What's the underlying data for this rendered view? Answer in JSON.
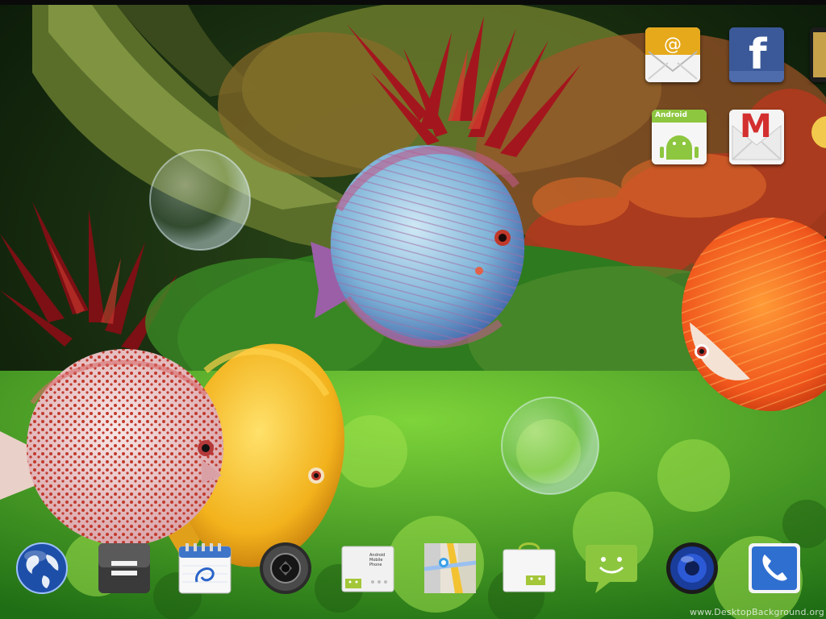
{
  "wallpaper": {
    "name": "aquarium live wallpaper",
    "colors": {
      "water": "#0c2a10",
      "plants": "#3fa52a",
      "redPlants": "#9c1a1a",
      "orangeFish": "#f0561c",
      "yellowFish": "#f2b21c",
      "blueFish": "#7fb4d8"
    }
  },
  "homescreen_icons": [
    {
      "name": "email-icon",
      "label": ""
    },
    {
      "name": "facebook-icon",
      "label": "f"
    },
    {
      "name": "android-market-icon",
      "label": "Android"
    },
    {
      "name": "gmail-icon",
      "label": "M"
    }
  ],
  "dock_icons": [
    {
      "name": "browser-globe-icon"
    },
    {
      "name": "calculator-icon"
    },
    {
      "name": "calendar-icon"
    },
    {
      "name": "camera-icon"
    },
    {
      "name": "android-mobile-phone-icon",
      "label": "Android Mobile Phone"
    },
    {
      "name": "maps-icon"
    },
    {
      "name": "android-market-bag-icon"
    },
    {
      "name": "messaging-icon"
    },
    {
      "name": "speaker-icon"
    },
    {
      "name": "phone-icon"
    }
  ],
  "watermark": "www.DesktopBackground.org"
}
